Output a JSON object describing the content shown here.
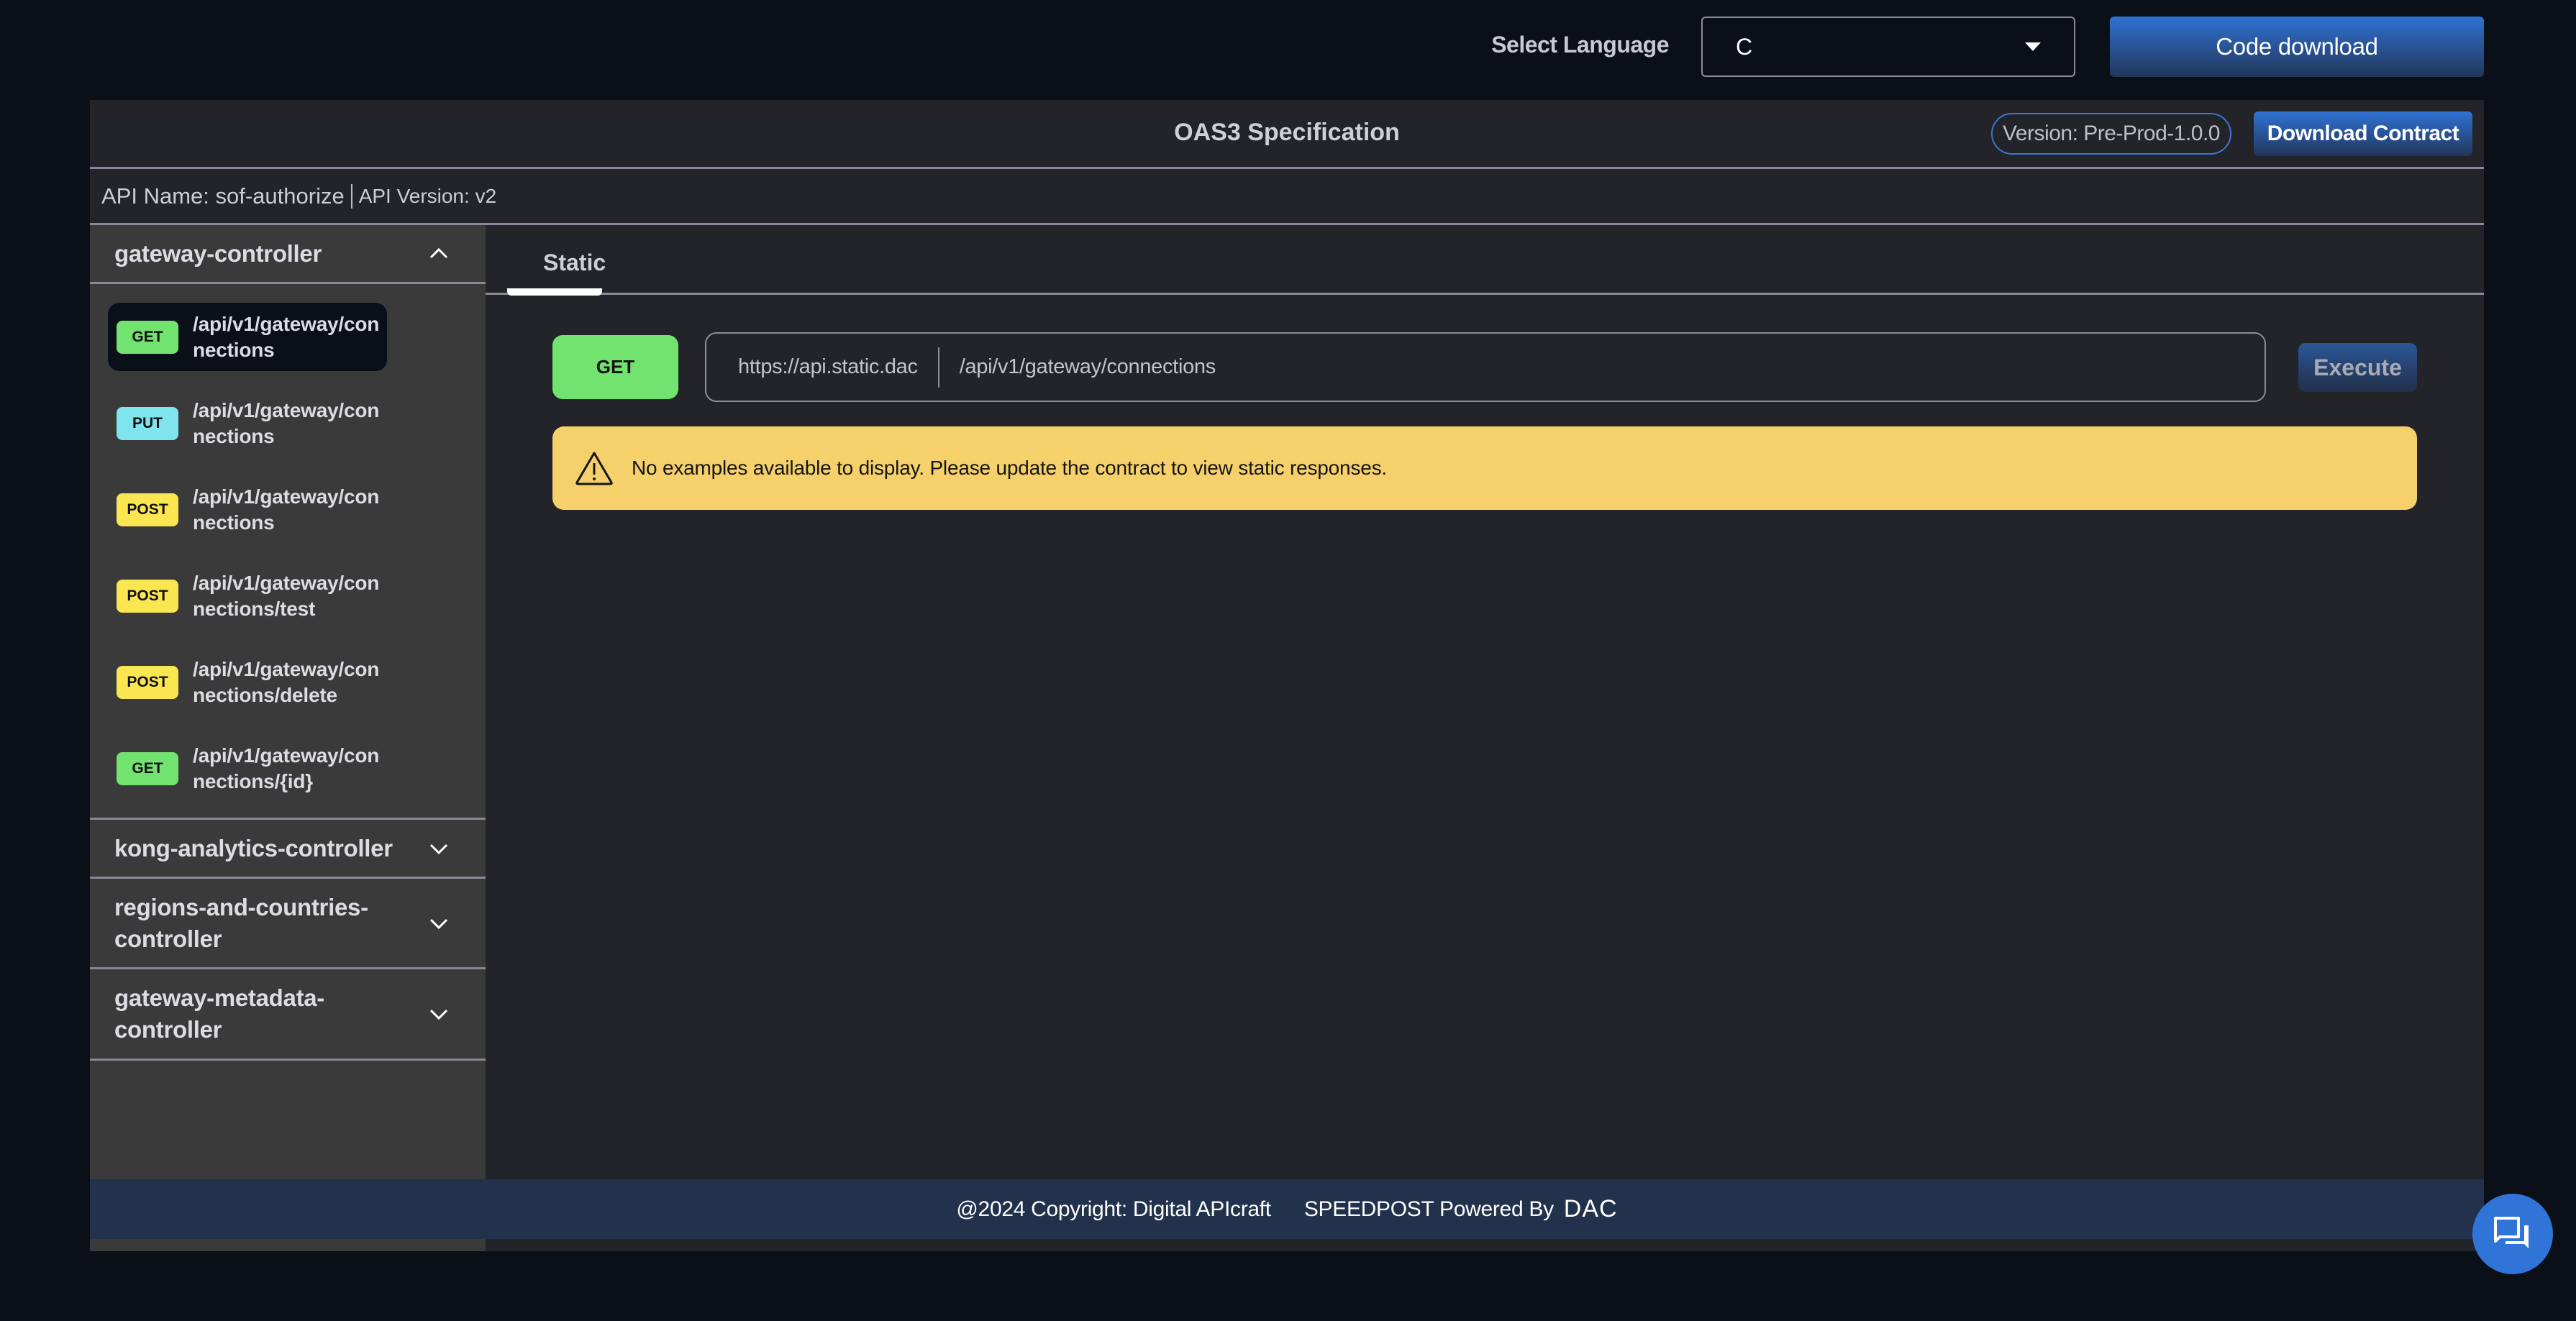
{
  "topbar": {
    "language_label": "Select Language",
    "language_value": "C",
    "code_download_label": "Code download"
  },
  "header": {
    "title": "OAS3 Specification",
    "version": "Version: Pre-Prod-1.0.0",
    "download_contract_label": "Download Contract"
  },
  "api_info": {
    "name": "API Name: sof-authorize",
    "version": "API Version: v2"
  },
  "sidebar": {
    "groups": [
      {
        "name": "gateway-controller",
        "expanded": true,
        "endpoints": [
          {
            "method": "GET",
            "path": "/api/v1/gateway/connections",
            "active": true
          },
          {
            "method": "PUT",
            "path": "/api/v1/gateway/connections",
            "active": false
          },
          {
            "method": "POST",
            "path": "/api/v1/gateway/connections",
            "active": false
          },
          {
            "method": "POST",
            "path": "/api/v1/gateway/connections/test",
            "active": false
          },
          {
            "method": "POST",
            "path": "/api/v1/gateway/connections/delete",
            "active": false
          },
          {
            "method": "GET",
            "path": "/api/v1/gateway/connections/{id}",
            "active": false
          }
        ]
      },
      {
        "name": "kong-analytics-controller",
        "expanded": false
      },
      {
        "name": "regions-and-countries-controller",
        "expanded": false
      },
      {
        "name": "gateway-metadata-controller",
        "expanded": false
      }
    ]
  },
  "method_colors": {
    "GET": "#72e36f",
    "PUT": "#80e4ee",
    "POST": "#fae650"
  },
  "content": {
    "tabs": [
      {
        "label": "Static",
        "active": true
      }
    ],
    "method": "GET",
    "base_url": "https://api.static.dac",
    "path": "/api/v1/gateway/connections",
    "execute_label": "Execute",
    "alert_message": "No examples available to display. Please update the contract to view static responses."
  },
  "footer": {
    "copyright": "@2024 Copyright: Digital APIcraft",
    "powered_by": "SPEEDPOST Powered By",
    "logo_text": "DAC"
  },
  "colors": {
    "accent": "#2f72d4",
    "alert_bg": "#f5d06b",
    "footer_bg": "#22314c"
  }
}
